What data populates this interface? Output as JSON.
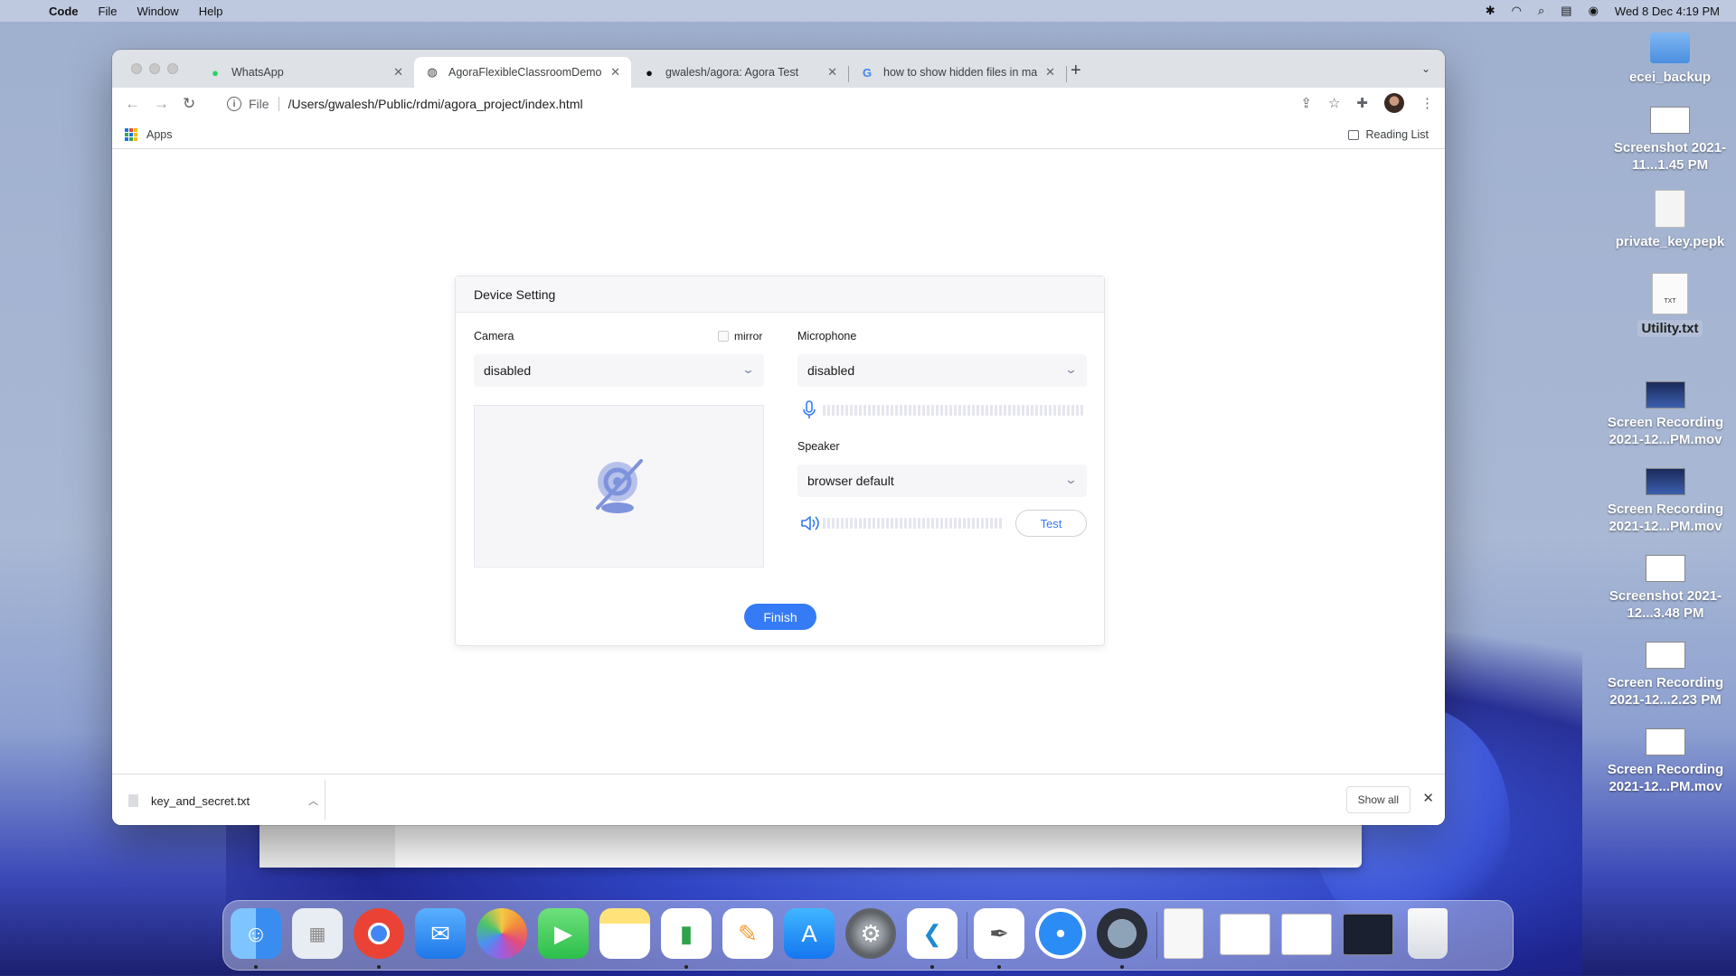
{
  "menubar": {
    "app_name": "Code",
    "menus": [
      "File",
      "Window",
      "Help"
    ],
    "datetime": "Wed 8 Dec  4:19 PM"
  },
  "browser": {
    "tabs": [
      {
        "title": "WhatsApp",
        "icon": "whatsapp-icon"
      },
      {
        "title": "AgoraFlexibleClassroomDemo",
        "icon": "globe-icon"
      },
      {
        "title": "gwalesh/agora: Agora Test",
        "icon": "github-icon"
      },
      {
        "title": "how to show hidden files in ma",
        "icon": "google-icon"
      }
    ],
    "active_tab": 1,
    "url_scheme": "File",
    "url": "/Users/gwalesh/Public/rdmi/agora_project/index.html",
    "bookmarks": {
      "apps": "Apps",
      "reading_list": "Reading List"
    }
  },
  "dialog": {
    "title": "Device Setting",
    "camera_label": "Camera",
    "mirror_label": "mirror",
    "camera_value": "disabled",
    "microphone_label": "Microphone",
    "microphone_value": "disabled",
    "speaker_label": "Speaker",
    "speaker_value": "browser default",
    "test_label": "Test",
    "finish_label": "Finish",
    "mic_level": 0,
    "speaker_level": 0
  },
  "downloads": {
    "file": "key_and_secret.txt",
    "show_all": "Show all"
  },
  "desktop": {
    "icons": [
      {
        "label": "ecei_backup",
        "kind": "folder"
      },
      {
        "label": "Screenshot 2021-11...1.45 PM",
        "kind": "thumb"
      },
      {
        "label": "private_key.pepk",
        "kind": "file"
      },
      {
        "label": "Utility.txt",
        "kind": "txt"
      },
      {
        "label": "Screen Recording 2021-12...PM.mov",
        "kind": "thumb-dark"
      },
      {
        "label": "Screen Recording 2021-12...PM.mov",
        "kind": "thumb-dark"
      },
      {
        "label": "Screenshot 2021-12...3.48 PM",
        "kind": "thumb"
      },
      {
        "label": "Screen Recording 2021-12...2.23 PM",
        "kind": "thumb"
      },
      {
        "label": "Screen Recording 2021-12...PM.mov",
        "kind": "thumb"
      }
    ],
    "txt_badge": "TXT"
  },
  "dock": {
    "apps": [
      "finder-icon",
      "launchpad-icon",
      "chrome-icon",
      "mail-icon",
      "photos-icon",
      "facetime-icon",
      "notes-icon",
      "numbers-icon",
      "pages-icon",
      "app-store-icon",
      "system-preferences-icon",
      "vscode-icon",
      "textedit-icon",
      "safari-icon",
      "quicktime-icon",
      "document-icon",
      "window-thumb-icon",
      "window-thumb-icon",
      "window-thumb-icon",
      "trash-icon"
    ]
  }
}
